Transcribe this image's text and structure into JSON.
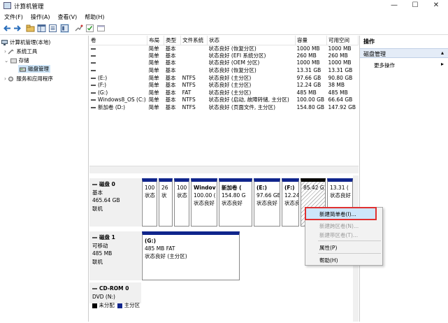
{
  "window": {
    "title": "计算机管理",
    "minimize": "—",
    "maximize": "☐",
    "close": "✕"
  },
  "menu": [
    "文件(F)",
    "操作(A)",
    "查看(V)",
    "帮助(H)"
  ],
  "tree": {
    "root": "计算机管理(本地)",
    "system_tools": "系统工具",
    "storage": "存储",
    "disk_management": "磁盘管理",
    "services": "服务和应用程序"
  },
  "volume_table": {
    "headers": [
      "卷",
      "布局",
      "类型",
      "文件系统",
      "状态",
      "容量",
      "可用空间"
    ],
    "rows": [
      [
        "",
        "简单",
        "基本",
        "",
        "状态良好 (恢复分区)",
        "1000 MB",
        "1000 MB"
      ],
      [
        "",
        "简单",
        "基本",
        "",
        "状态良好 (EFI 系统分区)",
        "260 MB",
        "260 MB"
      ],
      [
        "",
        "简单",
        "基本",
        "",
        "状态良好 (OEM 分区)",
        "1000 MB",
        "1000 MB"
      ],
      [
        "",
        "简单",
        "基本",
        "",
        "状态良好 (恢复分区)",
        "13.31 GB",
        "13.31 GB"
      ],
      [
        "(E:)",
        "简单",
        "基本",
        "NTFS",
        "状态良好 (主分区)",
        "97.66 GB",
        "90.80 GB"
      ],
      [
        "(F:)",
        "简单",
        "基本",
        "NTFS",
        "状态良好 (主分区)",
        "12.24 GB",
        "38 MB"
      ],
      [
        "(G:)",
        "简单",
        "基本",
        "FAT",
        "状态良好 (主分区)",
        "485 MB",
        "485 MB"
      ],
      [
        "Windows8_OS (C:)",
        "简单",
        "基本",
        "NTFS",
        "状态良好 (启动, 故障转储, 主分区)",
        "100.00 GB",
        "66.64 GB"
      ],
      [
        "新加卷 (D:)",
        "简单",
        "基本",
        "NTFS",
        "状态良好 (页面文件, 主分区)",
        "154.80 GB",
        "147.92 GB"
      ]
    ]
  },
  "disk0": {
    "name": "磁盘 0",
    "type": "基本",
    "size": "465.64 GB",
    "status": "联机",
    "partitions": [
      {
        "l1": "",
        "l2": "100",
        "l3": "状态"
      },
      {
        "l1": "",
        "l2": "26",
        "l3": "状"
      },
      {
        "l1": "",
        "l2": "100",
        "l3": "状态"
      },
      {
        "l1": "Windov",
        "l2": "100.00 (",
        "l3": "状态良好"
      },
      {
        "l1": "新加卷 (",
        "l2": "154.80 G",
        "l3": "状态良好"
      },
      {
        "l1": "(E:)",
        "l2": "97.66 GB",
        "l3": "状态良好"
      },
      {
        "l1": "(F:)",
        "l2": "12.24",
        "l3": "状态良"
      },
      {
        "l1": "",
        "l2": "85.42 G",
        "l3": ""
      },
      {
        "l1": "",
        "l2": "13.31 (",
        "l3": "状态良好"
      }
    ]
  },
  "disk1": {
    "name": "磁盘 1",
    "type": "可移动",
    "size": "485 MB",
    "status": "联机",
    "partition": {
      "l1": "(G:)",
      "l2": "485 MB FAT",
      "l3": "状态良好 (主分区)"
    }
  },
  "cdrom": {
    "name": "CD-ROM 0",
    "drive": "DVD (N:)"
  },
  "legend": {
    "unallocated": "未分配",
    "primary": "主分区"
  },
  "actions": {
    "header": "操作",
    "section": "磁盘管理",
    "more": "更多操作"
  },
  "context_menu": {
    "new_simple": "新建简单卷(I)...",
    "new_spanned": "新建跨区卷(N)...",
    "new_striped": "新建带区卷(T)...",
    "properties": "属性(P)",
    "help": "帮助(H)"
  },
  "colors": {
    "primary_partition": "#10258c",
    "unallocated": "#000000",
    "highlight": "#e03030",
    "accent": "#cce4f7"
  }
}
